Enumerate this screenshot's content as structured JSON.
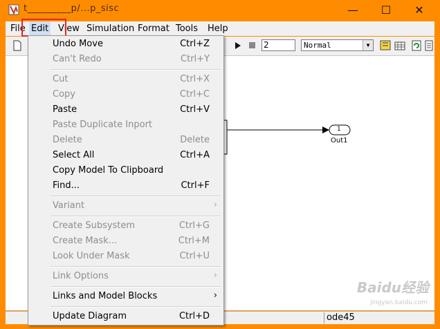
{
  "window": {
    "title": "t_________p/...p_sisc",
    "minimize": "—",
    "maximize": "☐",
    "close": "✕"
  },
  "menubar": {
    "file": "File",
    "edit": "Edit",
    "view": "View",
    "simulation": "Simulation",
    "format": "Format",
    "tools": "Tools",
    "help": "Help"
  },
  "toolbar": {
    "stop_time": "2",
    "sim_mode": "Normal"
  },
  "model": {
    "outport_number": "1",
    "outport_name": "Out1"
  },
  "edit_menu": [
    {
      "label": "Undo Move",
      "shortcut": "Ctrl+Z",
      "enabled": true
    },
    {
      "label": "Can't Redo",
      "shortcut": "Ctrl+Y",
      "enabled": false
    },
    {
      "label": "Cut",
      "shortcut": "Ctrl+X",
      "enabled": false
    },
    {
      "label": "Copy",
      "shortcut": "Ctrl+C",
      "enabled": false
    },
    {
      "label": "Paste",
      "shortcut": "Ctrl+V",
      "enabled": true
    },
    {
      "label": "Paste Duplicate Inport",
      "shortcut": "",
      "enabled": false
    },
    {
      "label": "Delete",
      "shortcut": "Delete",
      "enabled": false
    },
    {
      "label": "Select All",
      "shortcut": "Ctrl+A",
      "enabled": true
    },
    {
      "label": "Copy Model To Clipboard",
      "shortcut": "",
      "enabled": true
    },
    {
      "label": "Find...",
      "shortcut": "Ctrl+F",
      "enabled": true
    },
    {
      "label": "Variant",
      "shortcut": "",
      "enabled": false,
      "submenu": true
    },
    {
      "label": "Create Subsystem",
      "shortcut": "Ctrl+G",
      "enabled": false
    },
    {
      "label": "Create Mask...",
      "shortcut": "Ctrl+M",
      "enabled": false
    },
    {
      "label": "Look Under Mask",
      "shortcut": "Ctrl+U",
      "enabled": false
    },
    {
      "label": "Link Options",
      "shortcut": "",
      "enabled": false,
      "submenu": true
    },
    {
      "label": "Links and Model Blocks",
      "shortcut": "",
      "enabled": true,
      "submenu": true
    },
    {
      "label": "Update Diagram",
      "shortcut": "Ctrl+D",
      "enabled": true
    }
  ],
  "statusbar": {
    "solver": "ode45"
  },
  "watermark": {
    "brand": "Baidu经验",
    "url": "jingyan.baidu.com"
  },
  "icons": {
    "app": "simulink-app-icon",
    "play": "play-icon",
    "stop": "stop-icon"
  }
}
